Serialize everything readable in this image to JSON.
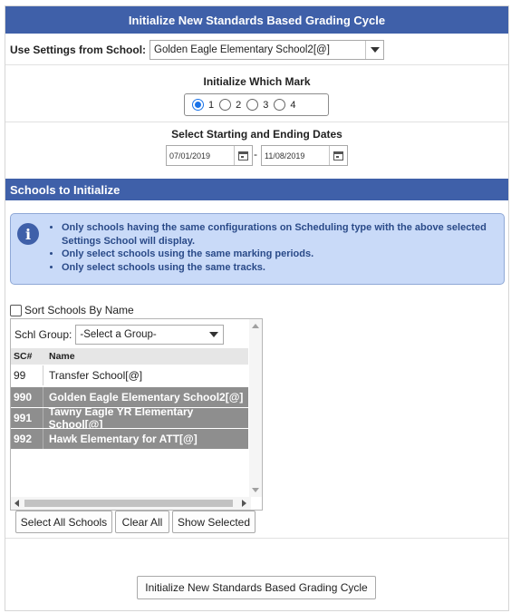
{
  "header": {
    "title": "Initialize New Standards Based Grading Cycle"
  },
  "settings": {
    "label": "Use Settings from School:",
    "selected": "Golden Eagle Elementary School2[@]"
  },
  "mark": {
    "title": "Initialize Which Mark",
    "options": [
      "1",
      "2",
      "3",
      "4"
    ],
    "selected": "1"
  },
  "dates": {
    "title": "Select Starting and Ending Dates",
    "start": "07/01/2019",
    "separator": "-",
    "end": "11/08/2019"
  },
  "schools_section": {
    "title": "Schools to Initialize"
  },
  "info": {
    "lines": [
      "Only schools having the same configurations on Scheduling type with the above selected Settings School will display.",
      "Only select schools using the same marking periods.",
      "Only select schools using the same tracks."
    ]
  },
  "sort": {
    "label": "Sort Schools By Name",
    "checked": false
  },
  "group": {
    "label": "Schl Group:",
    "selected": "-Select a Group-"
  },
  "table": {
    "columns": [
      "SC#",
      "Name"
    ],
    "rows": [
      {
        "sc": "99",
        "name": "Transfer School[@]",
        "selected": false
      },
      {
        "sc": "990",
        "name": "Golden Eagle Elementary School2[@]",
        "selected": true
      },
      {
        "sc": "991",
        "name": "Tawny Eagle YR Elementary School[@]",
        "selected": true
      },
      {
        "sc": "992",
        "name": "Hawk Elementary for ATT[@]",
        "selected": true
      }
    ]
  },
  "buttons": {
    "select_all": "Select All Schools",
    "clear_all": "Clear All",
    "show_selected": "Show Selected",
    "initialize": "Initialize New Standards Based Grading Cycle"
  },
  "colors": {
    "header_bg": "#3f60a9",
    "info_bg": "#c9daf8",
    "selected_row_bg": "#8e8e8e"
  }
}
